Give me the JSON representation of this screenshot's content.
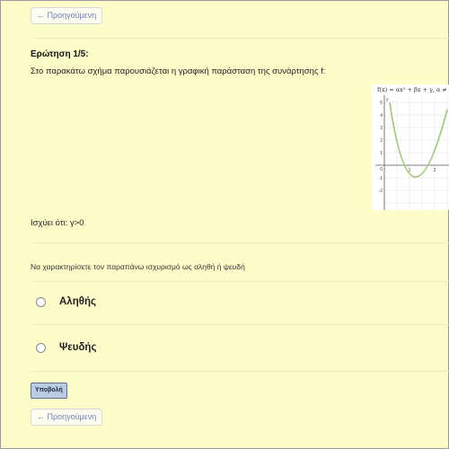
{
  "nav": {
    "previous_label": "← Προηγούμενη"
  },
  "question": {
    "title": "Ερώτηση 1/5:",
    "text": "Στο παρακάτω σχήμα παρουσιάζεται η γραφική παράσταση της συνάρτησης f:",
    "graph_formula": "f(x) = αx² + βx + γ,  α ≠",
    "graph_y_label": "y",
    "graph_y_ticks": [
      "5",
      "4",
      "3",
      "2",
      "1",
      "0",
      "-1",
      "-2"
    ],
    "graph_x_ticks": [
      "1",
      "2"
    ],
    "claim": "Ισχύει ότι: γ>0",
    "instruction": "Να χαρακτηρίσετε τον παραπάνω ισχυρισμό ως αληθή ή ψευδή"
  },
  "options": [
    {
      "label": "Αληθής",
      "selected": false
    },
    {
      "label": "Ψευδής",
      "selected": false
    }
  ],
  "submit_label": "Υποβολή",
  "colors": {
    "background": "#fdfdc9",
    "curve": "#a8c98a",
    "submit_bg": "#b9cce2"
  }
}
